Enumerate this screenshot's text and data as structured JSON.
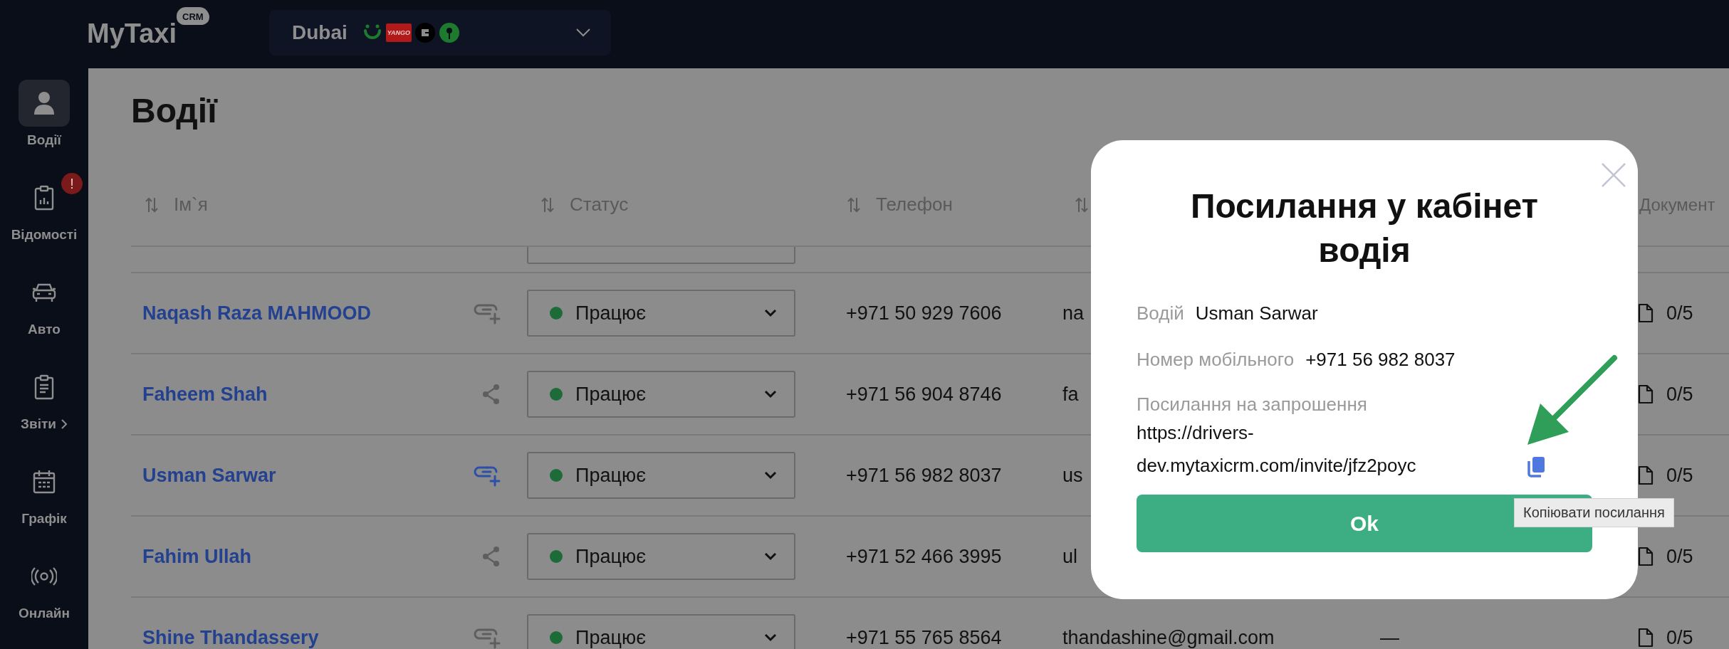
{
  "top_bar": {
    "logo": "MyTaxi",
    "logo_badge": "CRM",
    "city_selector": {
      "city": "Dubai",
      "services": [
        {
          "kind": "smile"
        },
        {
          "kind": "label",
          "text": "YANGO"
        },
        {
          "kind": "ring"
        },
        {
          "kind": "pin"
        }
      ]
    }
  },
  "sidebar": {
    "items": [
      {
        "label": "Водії",
        "kind": "person",
        "selected": true,
        "submenu": false
      },
      {
        "label": "Відомості",
        "kind": "report",
        "selected": false,
        "submenu": false,
        "badge": "!"
      },
      {
        "label": "Авто",
        "kind": "car",
        "selected": false,
        "submenu": false
      },
      {
        "label": "Звіти",
        "kind": "clipboard",
        "selected": false,
        "submenu": true
      },
      {
        "label": "Графік",
        "kind": "calendar",
        "selected": false,
        "submenu": false
      },
      {
        "label": "Онлайн",
        "kind": "broadcast",
        "selected": false,
        "submenu": false
      }
    ]
  },
  "page": {
    "title": "Водії"
  },
  "table": {
    "columns": [
      {
        "label": "Ім`я",
        "sort": true
      },
      {
        "label": "Статус",
        "sort": true
      },
      {
        "label": "Телефон",
        "sort": true
      },
      {
        "sort": true
      },
      {
        "label": "Документ",
        "sort": false
      }
    ],
    "rows": [
      {
        "name": "Naqash Raza MAHMOOD",
        "kind": "invite",
        "link_highlighted": false,
        "status": "Працює",
        "phone": "+971 50 929 7606",
        "email": "na",
        "documents": "0/5"
      },
      {
        "name": "Faheem Shah",
        "kind": "share",
        "link_highlighted": false,
        "status": "Працює",
        "phone": "+971 56 904 8746",
        "email": "fa",
        "documents": "0/5"
      },
      {
        "name": "Usman Sarwar",
        "kind": "invite",
        "link_highlighted": true,
        "status": "Працює",
        "phone": "+971 56 982 8037",
        "email": "us",
        "documents": "0/5"
      },
      {
        "name": "Fahim Ullah",
        "kind": "share",
        "link_highlighted": false,
        "status": "Працює",
        "phone": "+971 52 466 3995",
        "email": "ul",
        "documents": "0/5"
      },
      {
        "name": "Shine Thandassery",
        "kind": "invite",
        "link_highlighted": false,
        "status": "Працює",
        "phone": "+971 55 765 8564",
        "email": "thandashine@gmail.com",
        "column_5": "—",
        "documents": "0/5"
      }
    ]
  },
  "modal": {
    "title": "Посилання у кабінет водія",
    "fields": [
      {
        "label": "Водій",
        "value": "Usman Sarwar"
      },
      {
        "label": "Номер мобільного",
        "value": "+971 56 982 8037"
      }
    ],
    "invite": {
      "label": "Посилання на запрошення",
      "url": "https://drivers-dev.mytaxicrm.com/invite/jfz2poyc"
    },
    "tooltip": "Копіювати посилання",
    "ok_button": "Ok"
  }
}
